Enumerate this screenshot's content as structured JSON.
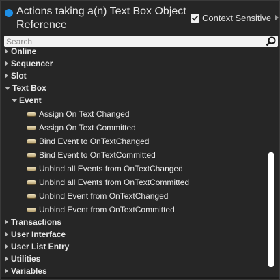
{
  "header": {
    "title": "Actions taking a(n) Text Box Object Reference",
    "context_sensitive_label": "Context Sensitive",
    "context_sensitive_checked": true,
    "accent_color": "#1e8fe6"
  },
  "search": {
    "placeholder": "Search",
    "value": ""
  },
  "tree": {
    "categories_top": [
      {
        "label": "Online",
        "expanded": false
      },
      {
        "label": "Sequencer",
        "expanded": false
      },
      {
        "label": "Slot",
        "expanded": false
      }
    ],
    "text_box": {
      "label": "Text Box",
      "expanded": true,
      "event": {
        "label": "Event",
        "expanded": true,
        "items": [
          "Assign On Text Changed",
          "Assign On Text Committed",
          "Bind Event to OnTextChanged",
          "Bind Event to OnTextCommitted",
          "Unbind all Events from OnTextChanged",
          "Unbind all Events from OnTextCommitted",
          "Unbind Event from OnTextChanged",
          "Unbind Event from OnTextCommitted"
        ]
      }
    },
    "categories_bottom": [
      {
        "label": "Transactions",
        "expanded": false
      },
      {
        "label": "User Interface",
        "expanded": false
      },
      {
        "label": "User List Entry",
        "expanded": false
      },
      {
        "label": "Utilities",
        "expanded": false
      },
      {
        "label": "Variables",
        "expanded": false
      }
    ]
  },
  "icons": {
    "context_checkbox": "check-icon",
    "search": "search-icon",
    "function": "function-icon",
    "collapsed": "triangle-right-icon",
    "expanded": "triangle-down-icon"
  }
}
